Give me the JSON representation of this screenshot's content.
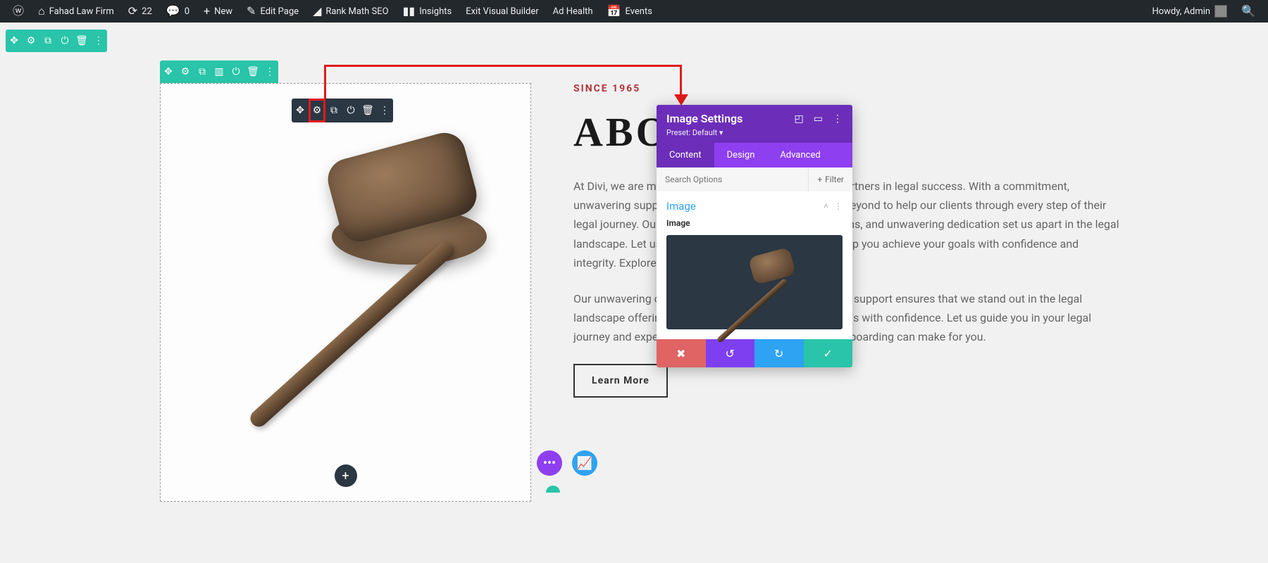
{
  "adminbar": {
    "site_name": "Fahad Law Firm",
    "updates": "22",
    "comments": "0",
    "new": "New",
    "edit_page": "Edit Page",
    "rank_math": "Rank Math SEO",
    "insights": "Insights",
    "exit_vb": "Exit Visual Builder",
    "ad_health": "Ad Health",
    "events": "Events",
    "greeting": "Howdy, Admin"
  },
  "page": {
    "eyebrow": "SINCE 1965",
    "heading": "ABOUT",
    "para1": "At Divi, we are more than just a law firm. We are your partners in legal success. With a commitment, unwavering support, and dedication, we go above and beyond to help our clients through every step of their legal journey. Our innovation, in-depth expertise, solutions, and unwavering dedication set us apart in the legal landscape. Let us redefine your legal experience and help you achieve your goals with confidence and integrity. Explore the difference with our law firm today.",
    "para2": "Our unwavering commitment, dedication, solutions, and support ensures that we stand out in the legal landscape offering solutions to help you reach your goals with confidence. Let us guide you in your legal journey and experience the difference that Paralegal Onboarding can make for you.",
    "learn_more": "Learn More"
  },
  "panel": {
    "title": "Image Settings",
    "preset": "Preset: Default",
    "tabs": {
      "content": "Content",
      "design": "Design",
      "advanced": "Advanced"
    },
    "search_placeholder": "Search Options",
    "filter": "Filter",
    "section": "Image",
    "field_label": "Image"
  },
  "icons": {
    "move": "✥",
    "gear": "⚙",
    "duplicate": "⧉",
    "columns": "▥",
    "power": "⏻",
    "trash": "🗑",
    "more": "⋮",
    "plus": "+",
    "focus": "◰",
    "drag": "▭",
    "chevup": "˄",
    "undo": "↺",
    "redo": "↻",
    "close": "✖",
    "check": "✓",
    "dots": "•••",
    "chart": "📈"
  }
}
